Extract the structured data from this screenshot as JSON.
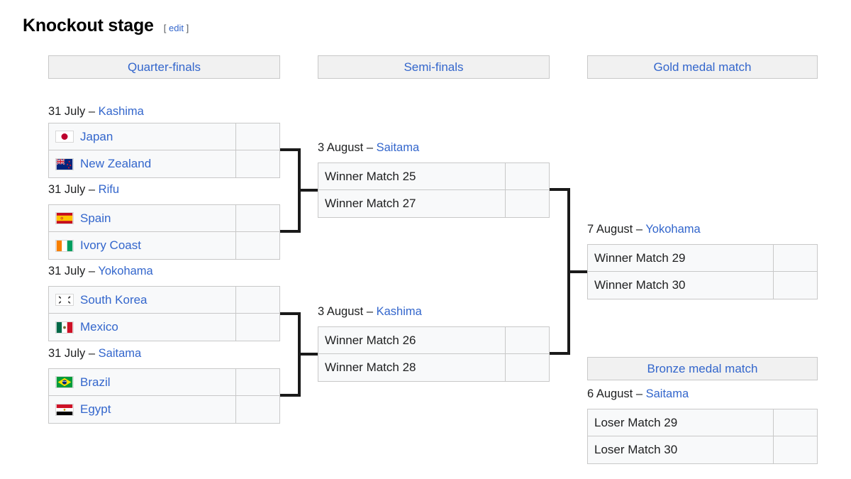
{
  "heading": {
    "title": "Knockout stage",
    "edit_open": "[",
    "edit_label": "edit",
    "edit_close": "]"
  },
  "colors": {
    "link": "#3366cc",
    "text": "#202122",
    "header_bg": "#f1f1f1",
    "cell_bg": "#f8f9fa",
    "border": "#c8c8c8",
    "connector": "#1a1a1a"
  },
  "rounds": [
    {
      "id": "quarter-finals",
      "label": "Quarter-finals"
    },
    {
      "id": "semi-finals",
      "label": "Semi-finals"
    },
    {
      "id": "gold-medal-match",
      "label": "Gold medal match"
    },
    {
      "id": "bronze-medal-match",
      "label": "Bronze medal match"
    }
  ],
  "matches": {
    "qf1": {
      "date": "31 July",
      "dash": "–",
      "venue": "Kashima",
      "teams": [
        {
          "name": "Japan",
          "flag": "japan",
          "score": ""
        },
        {
          "name": "New Zealand",
          "flag": "new-zealand",
          "score": ""
        }
      ]
    },
    "qf2": {
      "date": "31 July",
      "dash": "–",
      "venue": "Rifu",
      "teams": [
        {
          "name": "Spain",
          "flag": "spain",
          "score": ""
        },
        {
          "name": "Ivory Coast",
          "flag": "ivory-coast",
          "score": ""
        }
      ]
    },
    "qf3": {
      "date": "31 July",
      "dash": "–",
      "venue": "Yokohama",
      "teams": [
        {
          "name": "South Korea",
          "flag": "south-korea",
          "score": ""
        },
        {
          "name": "Mexico",
          "flag": "mexico",
          "score": ""
        }
      ]
    },
    "qf4": {
      "date": "31 July",
      "dash": "–",
      "venue": "Saitama",
      "teams": [
        {
          "name": "Brazil",
          "flag": "brazil",
          "score": ""
        },
        {
          "name": "Egypt",
          "flag": "egypt",
          "score": ""
        }
      ]
    },
    "sf1": {
      "date": "3 August",
      "dash": "–",
      "venue": "Saitama",
      "teams": [
        {
          "name": "Winner Match 25",
          "flag": null,
          "score": ""
        },
        {
          "name": "Winner Match 27",
          "flag": null,
          "score": ""
        }
      ]
    },
    "sf2": {
      "date": "3 August",
      "dash": "–",
      "venue": "Kashima",
      "teams": [
        {
          "name": "Winner Match 26",
          "flag": null,
          "score": ""
        },
        {
          "name": "Winner Match 28",
          "flag": null,
          "score": ""
        }
      ]
    },
    "gold": {
      "date": "7 August",
      "dash": "–",
      "venue": "Yokohama",
      "teams": [
        {
          "name": "Winner Match 29",
          "flag": null,
          "score": ""
        },
        {
          "name": "Winner Match 30",
          "flag": null,
          "score": ""
        }
      ]
    },
    "bronze": {
      "date": "6 August",
      "dash": "–",
      "venue": "Saitama",
      "teams": [
        {
          "name": "Loser Match 29",
          "flag": null,
          "score": ""
        },
        {
          "name": "Loser Match 30",
          "flag": null,
          "score": ""
        }
      ]
    }
  }
}
